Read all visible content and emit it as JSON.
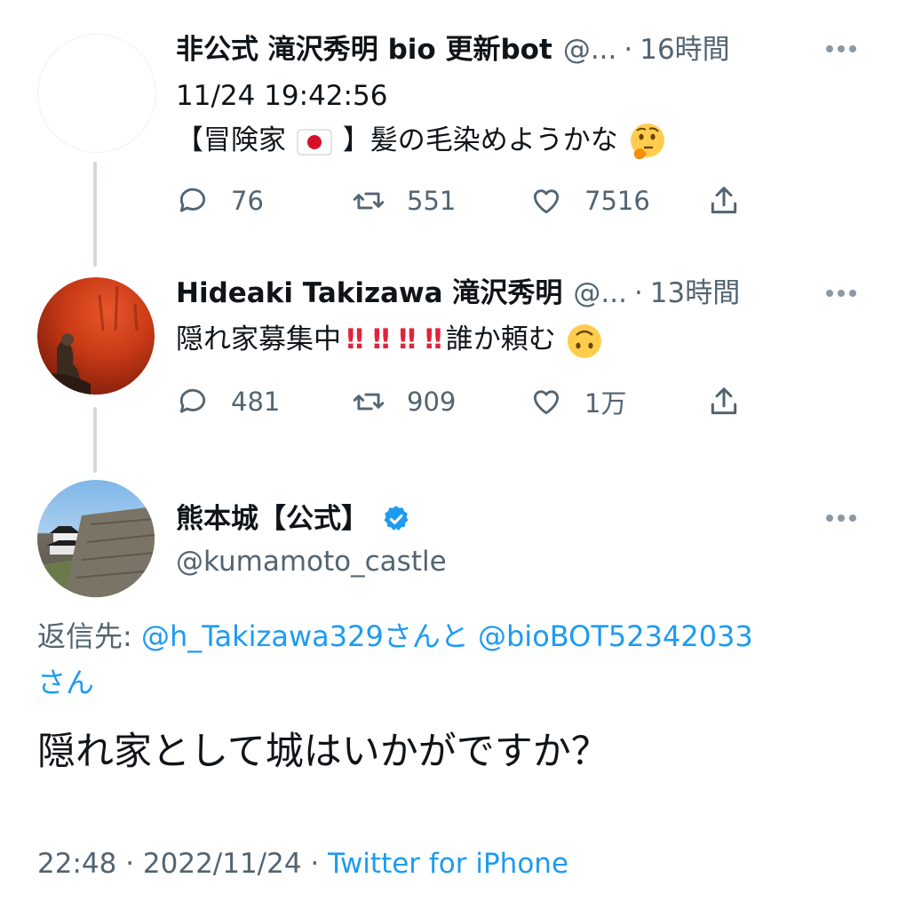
{
  "tweets": [
    {
      "name": "非公式 滝沢秀明 bio 更新bot",
      "handle": "@...",
      "time": "16時間",
      "line1": "11/24 19:42:56",
      "line2_a": "【冒険家",
      "line2_b": "】髪の毛染めようかな",
      "reply_count": "76",
      "retweet_count": "551",
      "like_count": "7516"
    },
    {
      "name": "Hideaki Takizawa 滝沢秀明",
      "handle": "@...",
      "time": "13時間",
      "text_a": "隠れ家募集中",
      "exclaim": "‼",
      "text_b": "誰か頼む",
      "reply_count": "481",
      "retweet_count": "909",
      "like_count": "1万"
    }
  ],
  "main": {
    "name": "熊本城【公式】",
    "handle": "@kumamoto_castle",
    "reply_prefix": "返信先:",
    "mention1": "@h_Takizawa329",
    "joiner": "さんと",
    "mention2": "@bioBOT52342033",
    "suffix": "さん",
    "text": "隠れ家として城はいかがですか？",
    "timestamp": "22:48 · 2022/11/24 · ",
    "client": "Twitter for iPhone"
  },
  "icons": {
    "reply": "reply-icon",
    "retweet": "retweet-icon",
    "like": "heart-icon",
    "share": "share-icon",
    "verified": "verified-badge-icon",
    "more": "more-icon"
  },
  "colors": {
    "link": "#1d9bf0",
    "muted": "#536471",
    "thread": "#cfd9de",
    "exclaim": "#e0243a",
    "verified": "#1d9bf0"
  }
}
